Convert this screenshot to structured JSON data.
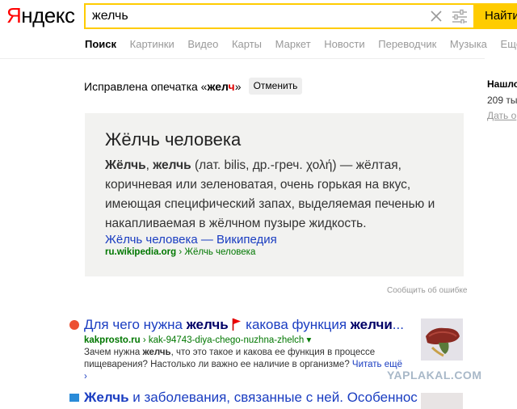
{
  "header": {
    "logo": "Яндекс",
    "search_value": "желчь",
    "find_button": "Найти"
  },
  "tabs": [
    {
      "label": "Поиск",
      "active": true
    },
    {
      "label": "Картинки"
    },
    {
      "label": "Видео"
    },
    {
      "label": "Карты"
    },
    {
      "label": "Маркет"
    },
    {
      "label": "Новости"
    },
    {
      "label": "Переводчик"
    },
    {
      "label": "Музыка"
    },
    {
      "label": "Ещё"
    }
  ],
  "correction": {
    "text_prefix": "Исправлена опечатка «",
    "word_main": "жел",
    "word_fixed_letter": "ч",
    "text_suffix": "»",
    "cancel_button": "Отменить"
  },
  "sidebar": {
    "title": "Нашло",
    "count": "209 ты",
    "link": "Дать о"
  },
  "fact_card": {
    "title": "Жёлчь человека",
    "bold1": "Жёлчь",
    "sep": ", ",
    "bold2": "желчь",
    "definition": " (лат. bilis, др.-греч. χολή) — жёлтая, коричневая или зеленоватая, очень горькая на вкус, имеющая специфический запах, выделяемая печенью и накапливаемая в жёлчном пузыре жидкость.",
    "link_text": "Жёлчь человека — Википедия",
    "domain": "ru.wikipedia.org",
    "path": " › Жёлчь человека",
    "report": "Сообщить об ошибке"
  },
  "results": [
    {
      "title_parts": [
        "Для чего нужна ",
        "желчь",
        " какова функция ",
        "желчи",
        "..."
      ],
      "domain": "kakprosto.ru",
      "path": " › kak-94743-diya-chego-nuzhna-zhelch ▾",
      "snippet_a": "Зачем нужна ",
      "snippet_bold": "желчь",
      "snippet_b": ", что это такое и какова ее функция в процессе пищеварения? Настолько ли важно ее наличие в организме? ",
      "more": "Читать ещё ›"
    },
    {
      "title_parts": [
        "Желчь",
        " и заболевания, связанные с ней. Особеннос"
      ]
    }
  ],
  "watermark": "YAPLAKAL.COM",
  "colors": {
    "accent": "#ffcc00",
    "link": "#1a3dc1",
    "url": "#007700",
    "brand_red": "#ff0000"
  }
}
